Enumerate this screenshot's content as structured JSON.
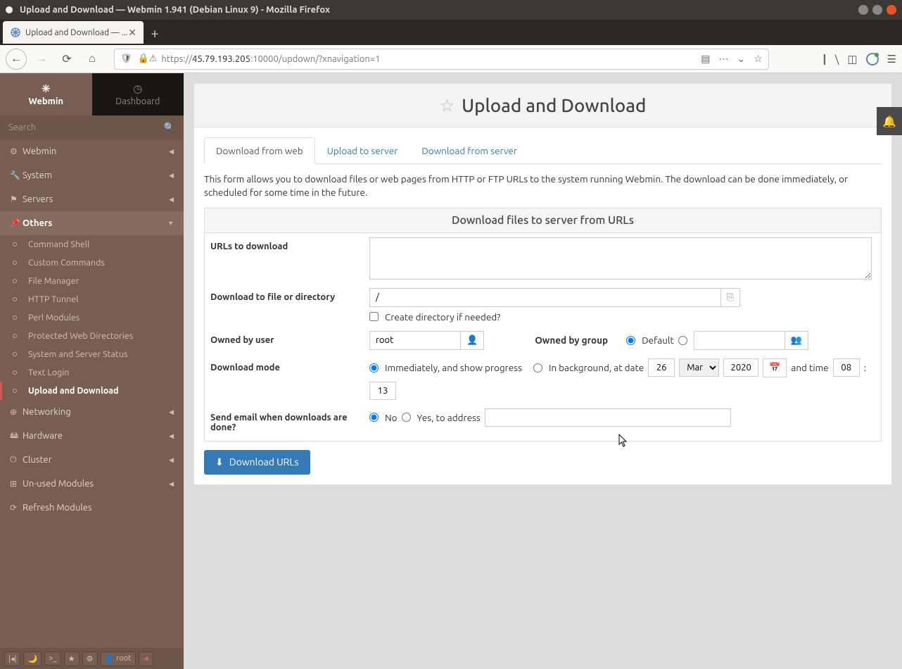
{
  "window": {
    "title": "Upload and Download — Webmin 1.941 (Debian Linux 9) - Mozilla Firefox"
  },
  "tab": {
    "title": "Upload and Download — ..."
  },
  "url": {
    "prefix": "https://",
    "host": "45.79.193.205",
    "rest": ":10000/updown/?xnavigation=1"
  },
  "sidebar": {
    "tabs": {
      "webmin": "Webmin",
      "dashboard": "Dashboard"
    },
    "search_placeholder": "Search",
    "items": [
      {
        "icon": "⚙",
        "label": "Webmin"
      },
      {
        "icon": "🔧",
        "label": "System"
      },
      {
        "icon": "⚑",
        "label": "Servers"
      },
      {
        "icon": "📌",
        "label": "Others"
      },
      {
        "icon": "⊕",
        "label": "Networking"
      },
      {
        "icon": "🖴",
        "label": "Hardware"
      },
      {
        "icon": "⏻",
        "label": "Cluster"
      },
      {
        "icon": "⊞",
        "label": "Un-used Modules"
      },
      {
        "icon": "⟳",
        "label": "Refresh Modules"
      }
    ],
    "subitems": [
      "Command Shell",
      "Custom Commands",
      "File Manager",
      "HTTP Tunnel",
      "Perl Modules",
      "Protected Web Directories",
      "System and Server Status",
      "Text Login",
      "Upload and Download"
    ],
    "user": "root"
  },
  "page": {
    "title": "Upload and Download",
    "tabs": {
      "download_web": "Download from web",
      "upload": "Upload to server",
      "download_server": "Download from server"
    },
    "description": "This form allows you to download files or web pages from HTTP or FTP URLs to the system running Webmin. The download can be done immediately, or scheduled for some time in the future.",
    "form_title": "Download files to server from URLs",
    "labels": {
      "urls": "URLs to download",
      "dir": "Download to file or directory",
      "create_dir": "Create directory if needed?",
      "owner_user": "Owned by user",
      "owner_group": "Owned by group",
      "default": "Default",
      "mode": "Download mode",
      "immediate": "Immediately, and show progress",
      "background": "In background, at date",
      "and_time": "and time",
      "colon": ":",
      "email": "Send email when downloads are done?",
      "no": "No",
      "yes": "Yes, to address",
      "button": "Download URLs"
    },
    "values": {
      "dir": "/",
      "user": "root",
      "day": "26",
      "month": "Mar",
      "year": "2020",
      "hour": "08",
      "min": "13"
    }
  }
}
